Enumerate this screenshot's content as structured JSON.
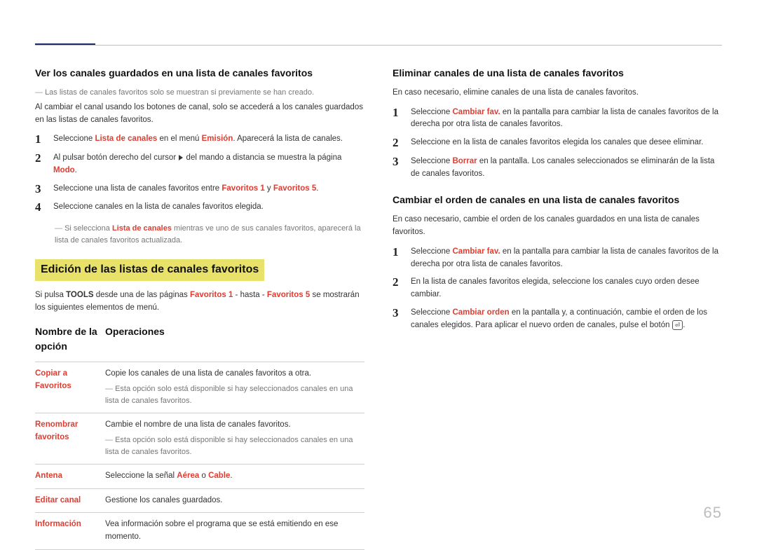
{
  "page_number": "65",
  "left": {
    "h_view": "Ver los canales guardados en una lista de canales favoritos",
    "note_view": "Las listas de canales favoritos solo se muestran si previamente se han creado.",
    "para_view": "Al cambiar el canal usando los botones de canal, solo se accederá a los canales guardados en las listas de canales favoritos.",
    "steps": [
      {
        "pre": "Seleccione ",
        "r1": "Lista de canales",
        "mid": " en el menú ",
        "r2": "Emisión",
        "post": ". Aparecerá la lista de canales."
      },
      {
        "pre": "Al pulsar botón derecho del cursor ",
        "icon": true,
        "mid": " del mando a distancia se muestra la página ",
        "r1": "Modo",
        "post": "."
      },
      {
        "pre": "Seleccione una lista de canales favoritos entre ",
        "r1": "Favoritos 1",
        "mid": " y ",
        "r2": "Favoritos 5",
        "post": "."
      },
      {
        "pre": "Seleccione canales en la lista de canales favoritos elegida.",
        "plain": true
      }
    ],
    "after_note_pre": "Si selecciona ",
    "after_note_r": "Lista de canales",
    "after_note_post": " mientras ve uno de sus canales favoritos, aparecerá la lista de canales favoritos actualizada.",
    "h_edit": "Edición de las listas de canales favoritos",
    "tools_pre": "Si pulsa ",
    "tools_b": "TOOLS",
    "tools_mid": " desde una de las páginas ",
    "tools_r1": "Favoritos 1",
    "tools_mid2": " - hasta - ",
    "tools_r2": "Favoritos 5",
    "tools_post": " se mostrarán los siguientes elementos de menú.",
    "th_name": "Nombre de la opción",
    "th_ops": "Operaciones",
    "rows": [
      {
        "name": "Copiar a Favoritos",
        "desc": "Copie los canales de una lista de canales favoritos a otra.",
        "note": "Esta opción solo está disponible si hay seleccionados canales en una lista de canales favoritos."
      },
      {
        "name": "Renombrar favoritos",
        "desc": "Cambie el nombre de una lista de canales favoritos.",
        "note": "Esta opción solo está disponible si hay seleccionados canales en una lista de canales favoritos."
      },
      {
        "name": "Antena",
        "desc_pre": "Seleccione la señal ",
        "r1": "Aérea",
        "mid": " o ",
        "r2": "Cable",
        "post": "."
      },
      {
        "name": "Editar canal",
        "desc": "Gestione los canales guardados."
      },
      {
        "name": "Información",
        "desc": "Vea información sobre el programa que se está emitiendo en ese momento."
      }
    ]
  },
  "right": {
    "h_del": "Eliminar canales de una lista de canales favoritos",
    "para_del": "En caso necesario, elimine canales de una lista de canales favoritos.",
    "del_steps": [
      {
        "pre": "Seleccione ",
        "r1": "Cambiar fav.",
        "post": " en la pantalla para cambiar la lista de canales favoritos de la derecha por otra lista de canales favoritos."
      },
      {
        "pre": "Seleccione en la lista de canales favoritos elegida los canales que desee eliminar.",
        "plain": true
      },
      {
        "pre": "Seleccione ",
        "r1": "Borrar",
        "post": " en la pantalla. Los canales seleccionados se eliminarán de la lista de canales favoritos."
      }
    ],
    "h_order": "Cambiar el orden de canales en una lista de canales favoritos",
    "para_order": "En caso necesario, cambie el orden de los canales guardados en una lista de canales favoritos.",
    "order_steps": [
      {
        "pre": "Seleccione ",
        "r1": "Cambiar fav.",
        "post": " en la pantalla para cambiar la lista de canales favoritos de la derecha por otra lista de canales favoritos."
      },
      {
        "pre": "En la lista de canales favoritos elegida, seleccione los canales cuyo orden desee cambiar.",
        "plain": true
      },
      {
        "pre": "Seleccione ",
        "r1": "Cambiar orden",
        "post": " en la pantalla y, a continuación, cambie el orden de los canales elegidos. Para aplicar el nuevo orden de canales, pulse el botón ",
        "icon": true,
        "tail": "."
      }
    ]
  }
}
